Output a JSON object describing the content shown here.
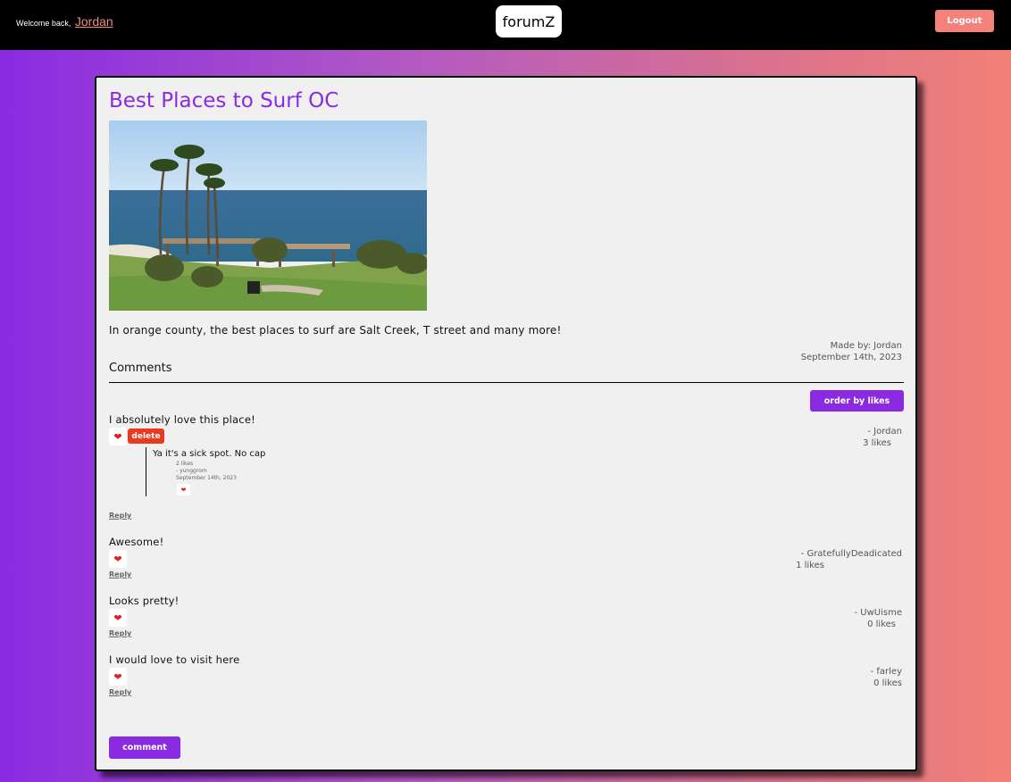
{
  "header": {
    "welcome_prefix": "Welcome back,",
    "username": "Jordan",
    "logo": "forumZ",
    "logout_label": "Logout"
  },
  "post": {
    "title": "Best Places to Surf OC",
    "image_icon": "beach-photo",
    "body": "In orange county, the best places to surf are Salt Creek, T street and many more!",
    "made_by": "Made by: Jordan",
    "date": "September 14th, 2023"
  },
  "comments_section": {
    "heading": "Comments",
    "order_button": "order by likes",
    "comment_button": "comment",
    "comments": [
      {
        "text": "I absolutely love this place!",
        "author": "- Jordan",
        "likes": "3 likes",
        "delete_label": "delete",
        "reply_label": "Reply",
        "replies": [
          {
            "text": "Ya it's a sick spot. No cap",
            "likes": "2 likes",
            "author": "- yunggrom",
            "date": "September 14th, 2023"
          }
        ]
      },
      {
        "text": "Awesome!",
        "author": "- GratefullyDeadicated",
        "likes": "1 likes",
        "reply_label": "Reply"
      },
      {
        "text": "Looks pretty!",
        "author": "- UwUisme",
        "likes": "0 likes",
        "reply_label": "Reply"
      },
      {
        "text": "I would love to visit here",
        "author": "- farley",
        "likes": "0 likes",
        "reply_label": "Reply"
      }
    ]
  },
  "colors": {
    "accent": "#8a2be2",
    "logout": "#f4817a",
    "delete": "#e83a1e",
    "username": "#f08a7e"
  },
  "icons": {
    "like": "heart-icon"
  }
}
